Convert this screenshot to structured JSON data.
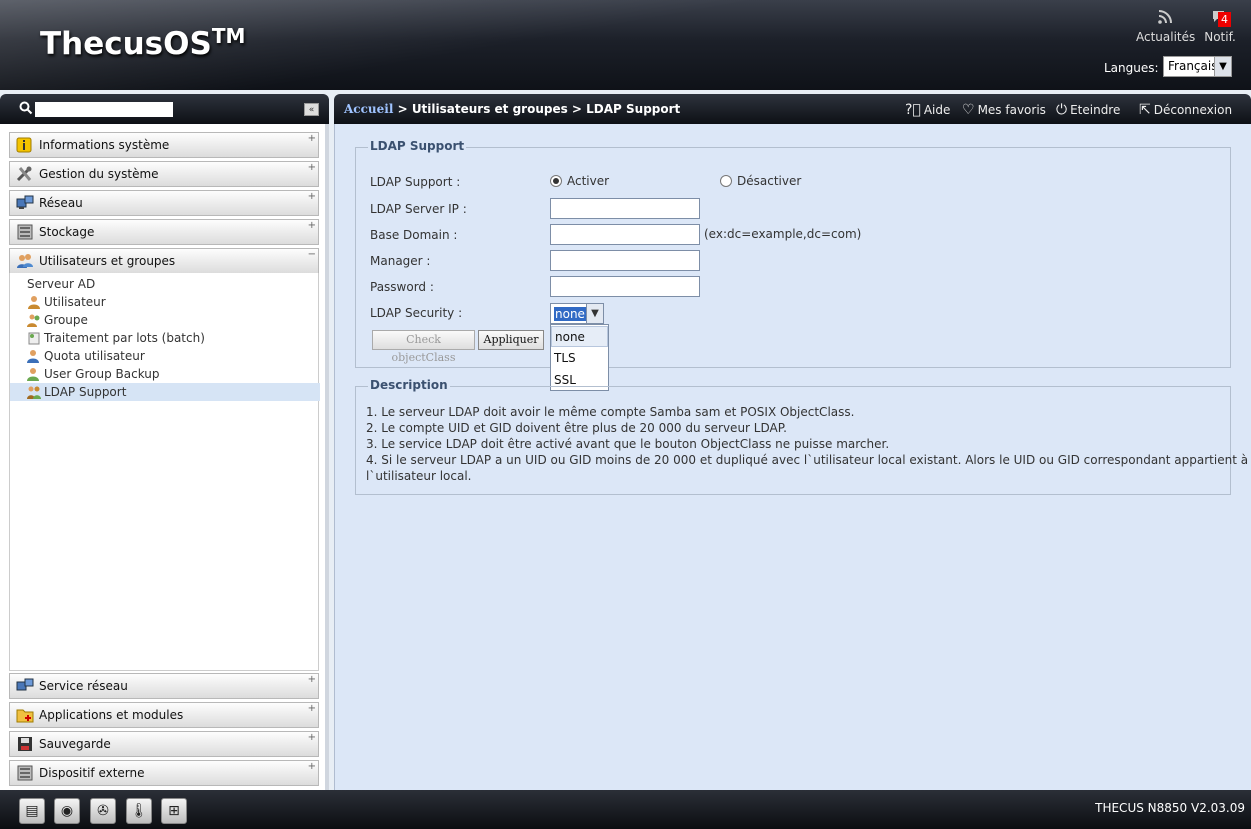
{
  "app": {
    "logo": "ThecusOS",
    "logo_sup": "TM",
    "version": "THECUS N8850 V2.03.09"
  },
  "header": {
    "rss_label": "Actualités",
    "notif_label": "Notif.",
    "notif_count": "4",
    "lang_label": "Langues:",
    "lang_value": "Français"
  },
  "sidebar": {
    "collapse": "«",
    "top_items": [
      {
        "label": "Informations système",
        "pm": "+"
      },
      {
        "label": "Gestion du système",
        "pm": "+"
      },
      {
        "label": "Réseau",
        "pm": "+"
      },
      {
        "label": "Stockage",
        "pm": "+"
      },
      {
        "label": "Utilisateurs et groupes",
        "pm": "−"
      }
    ],
    "tree_items": [
      {
        "label": "Serveur AD"
      },
      {
        "label": "Utilisateur"
      },
      {
        "label": "Groupe"
      },
      {
        "label": "Traitement par lots (batch)"
      },
      {
        "label": "Quota utilisateur"
      },
      {
        "label": "User Group Backup"
      },
      {
        "label": "LDAP Support"
      }
    ],
    "bottom_items": [
      {
        "label": "Service réseau",
        "pm": "+"
      },
      {
        "label": "Applications et modules",
        "pm": "+"
      },
      {
        "label": "Sauvegarde",
        "pm": "+"
      },
      {
        "label": "Dispositif externe",
        "pm": "+"
      }
    ]
  },
  "breadcrumb": {
    "home": "Accueil",
    "rest": " > Utilisateurs et groupes > LDAP Support"
  },
  "top_actions": {
    "help": "Aide",
    "favorites": "Mes favoris",
    "shutdown": "Eteindre",
    "logout": "Déconnexion"
  },
  "ldap": {
    "legend": "LDAP Support",
    "support_label": "LDAP Support :",
    "enable": "Activer",
    "disable": "Désactiver",
    "enabled": true,
    "server_ip_label": "LDAP Server IP :",
    "server_ip_value": "",
    "base_domain_label": "Base Domain :",
    "base_domain_value": "",
    "base_domain_hint": "(ex:dc=example,dc=com)",
    "manager_label": "Manager :",
    "manager_value": "",
    "password_label": "Password :",
    "password_value": "",
    "security_label": "LDAP Security :",
    "security_value": "none",
    "security_options": [
      "none",
      "TLS",
      "SSL"
    ],
    "check_button": "Check objectClass",
    "apply_button": "Appliquer"
  },
  "description": {
    "legend": "Description",
    "lines": [
      "1. Le serveur LDAP doit avoir le même compte Samba sam et POSIX ObjectClass.",
      "2. Le compte UID et GID doivent être plus de 20 000 du serveur LDAP.",
      "3. Le service LDAP doit être activé avant que le bouton ObjectClass ne puisse marcher.",
      "4. Si le serveur LDAP a un UID ou GID moins de 20 000 et dupliqué avec l`utilisateur local existant. Alors le UID ou GID correspondant appartient à",
      "l`utilisateur local."
    ]
  },
  "footer_icons": [
    "server-icon",
    "disk-icon",
    "fan-icon",
    "thermometer-icon",
    "network-icon"
  ]
}
